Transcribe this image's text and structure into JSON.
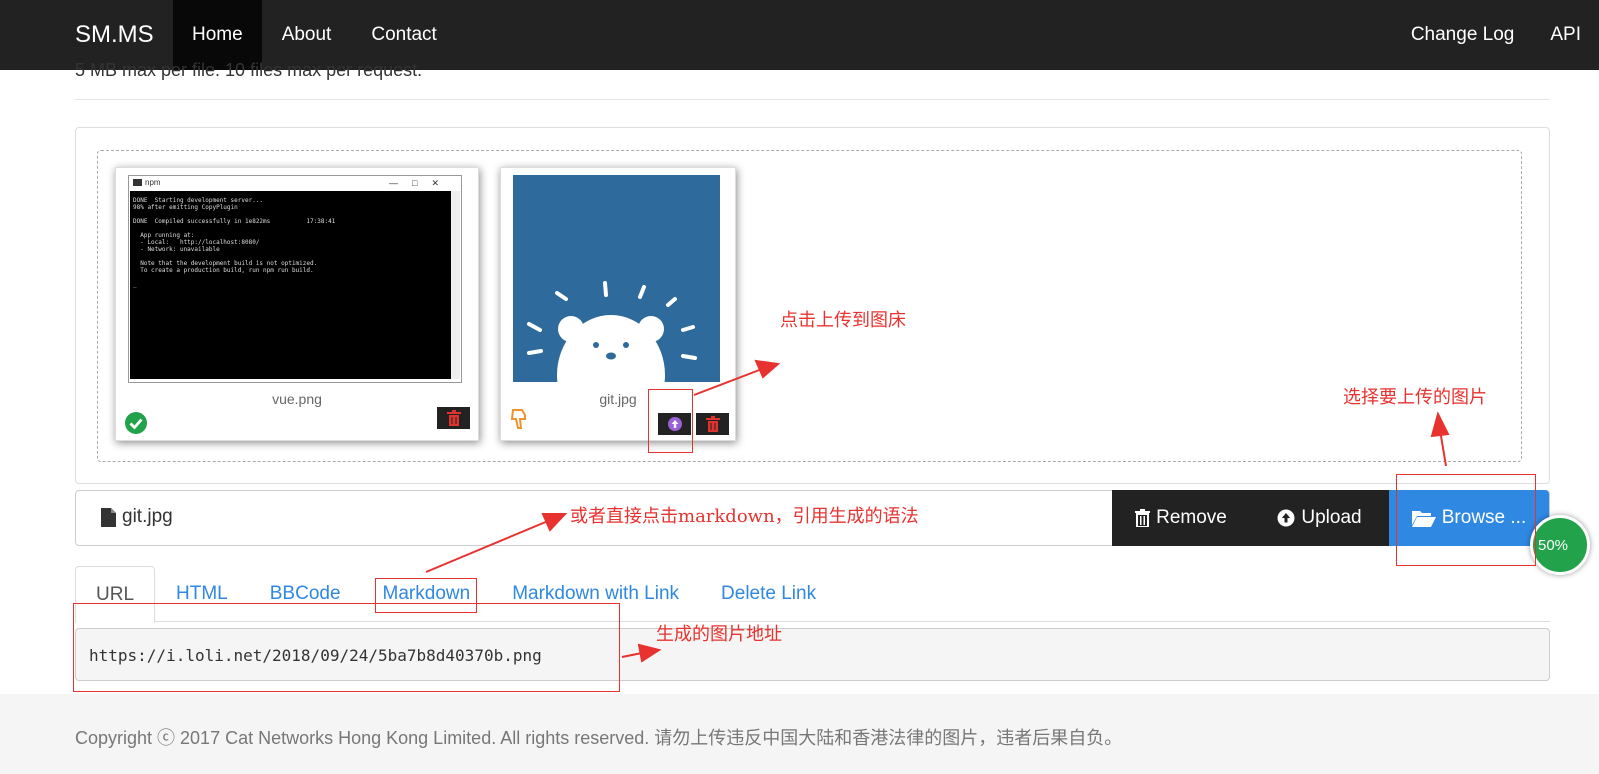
{
  "navbar": {
    "brand": "SM.MS",
    "items": [
      {
        "label": "Home"
      },
      {
        "label": "About"
      },
      {
        "label": "Contact"
      }
    ],
    "right_items": [
      {
        "label": "Change Log"
      },
      {
        "label": "API"
      }
    ]
  },
  "top_note": "5 MB max per file. 10 files max per request.",
  "previews": [
    {
      "filename": "vue.png",
      "status": "success",
      "status_icon": "check-circle-icon",
      "terminal": {
        "title": "npm",
        "controls": "—□✕",
        "lines": "DONE  Starting development server...\n98% after emitting CopyPlugin\n\nDONE  Compiled successfully in 1e822ms          17:38:41\n\n  App running at:\n  - Local:   http://localhost:8080/\n  - Network: unavailable\n\n  Note that the development build is not optimized.\n  To create a production build, run npm run build.\n\n_"
      }
    },
    {
      "filename": "git.jpg",
      "status": "pending",
      "status_icon": "hand-pointer-icon"
    }
  ],
  "file_bar": {
    "file_name": "git.jpg",
    "remove_label": "Remove",
    "upload_label": "Upload",
    "browse_label": "Browse ..."
  },
  "tabs": [
    {
      "label": "URL",
      "active": true
    },
    {
      "label": "HTML"
    },
    {
      "label": "BBCode"
    },
    {
      "label": "Markdown"
    },
    {
      "label": "Markdown with Link"
    },
    {
      "label": "Delete Link"
    }
  ],
  "result_url": "https://i.loli.net/2018/09/24/5ba7b8d40370b.png",
  "footer": "Copyright ⓒ 2017 Cat Networks Hong Kong Limited. All rights reserved. 请勿上传违反中国大陆和香港法律的图片，违者后果自负。",
  "annotations": {
    "click_upload": "点击上传到图床",
    "choose_image": "选择要上传的图片",
    "markdown_hint": "或者直接点击markdown，引用生成的语法",
    "url_hint": "生成的图片地址"
  },
  "progress_badge": "50%",
  "colors": {
    "navbar": "#222222",
    "accent_blue": "#2f88e2",
    "annotation_red": "#e8322f",
    "delete_red": "#e0322f",
    "success_green": "#22a24a"
  }
}
